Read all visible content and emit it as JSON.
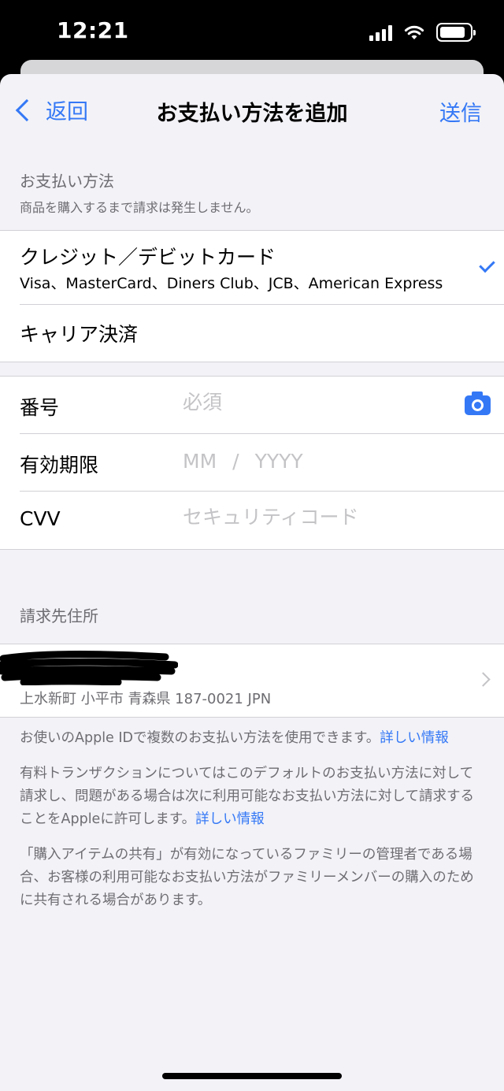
{
  "status_bar": {
    "time": "12:21",
    "signal_icon": "cellular-signal-icon",
    "wifi_icon": "wifi-icon",
    "battery_icon": "battery-icon",
    "battery_level": 0.85
  },
  "nav": {
    "back_label": "返回",
    "title": "お支払い方法を追加",
    "send_label": "送信"
  },
  "payment_section": {
    "header": "お支払い方法",
    "subheader": "商品を購入するまで請求は発生しません。"
  },
  "payment_methods": [
    {
      "title": "クレジット／デビットカード",
      "subtitle": "Visa、MasterCard、Diners Club、JCB、American Express",
      "selected": true
    },
    {
      "title": "キャリア決済",
      "selected": false
    }
  ],
  "card_form": {
    "number_label": "番号",
    "number_placeholder": "必須",
    "expiry_label": "有効期限",
    "expiry_month_placeholder": "MM",
    "expiry_separator": "/",
    "expiry_year_placeholder": "YYYY",
    "cvv_label": "CVV",
    "cvv_placeholder": "セキュリティコード",
    "camera_icon": "camera-icon"
  },
  "billing": {
    "header": "請求先住所",
    "address": "上水新町 小平市 青森県 187-0021 JPN"
  },
  "footer": {
    "p1_text": "お使いのApple IDで複数のお支払い方法を使用できます。",
    "p1_link": "詳しい情報",
    "p2_text": "有料トランザクションについてはこのデフォルトのお支払い方法に対して請求し、問題がある場合は次に利用可能なお支払い方法に対して請求することをAppleに許可します。",
    "p2_link": "詳しい情報",
    "p3_text": "「購入アイテムの共有」が有効になっているファミリーの管理者である場合、お客様の利用可能なお支払い方法がファミリーメンバーの購入のために共有される場合があります。"
  },
  "colors": {
    "accent": "#3478f6",
    "background": "#f2f2f7",
    "secondary_text": "#6d6d72",
    "placeholder": "#c4c4c7"
  }
}
